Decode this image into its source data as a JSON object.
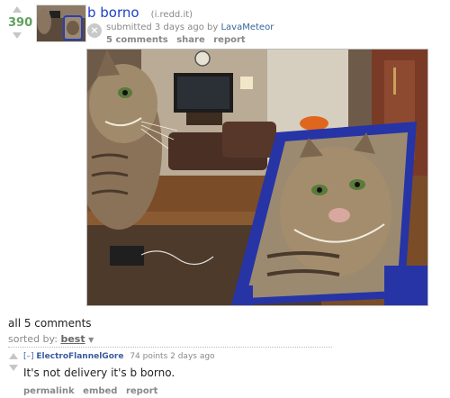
{
  "post": {
    "score": "390",
    "title": "b borno",
    "domain": "(i.redd.it)",
    "submitted_prefix": "submitted 3 days ago by",
    "author": "LavaMeteor",
    "buttons": [
      "5 comments",
      "share",
      "report"
    ],
    "hide_glyph": "×"
  },
  "comments_section": {
    "title": "all 5 comments",
    "sorted_label": "sorted by:",
    "sorted_value": "best",
    "sort_arrow": "▼"
  },
  "comment": {
    "toggle": "[–]",
    "author": "ElectroFlannelGore",
    "meta": "74 points 2 days ago",
    "body": "It's not delivery it's b borno.",
    "buttons": [
      "permalink",
      "embed",
      "report"
    ]
  },
  "colors": {
    "score": "#5fa05f",
    "title_link": "#1f3fcc",
    "author_link": "#369"
  }
}
